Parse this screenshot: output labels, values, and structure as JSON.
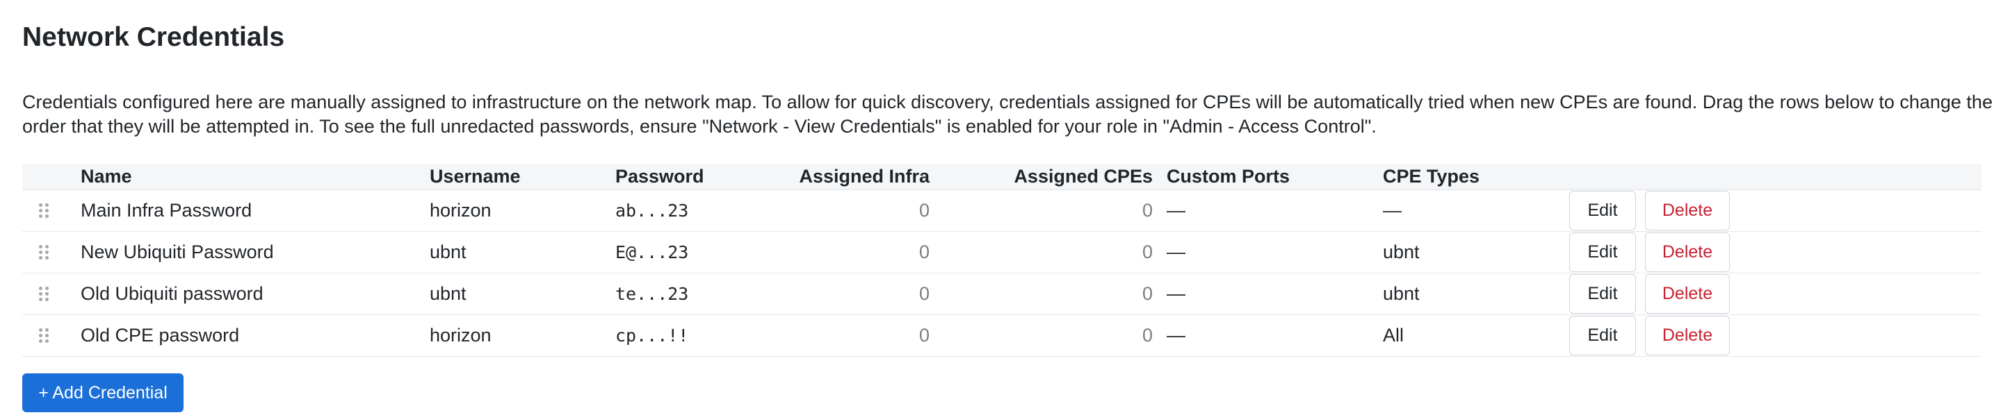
{
  "page": {
    "title": "Network Credentials",
    "description": "Credentials configured here are manually assigned to infrastructure on the network map. To allow for quick discovery, credentials assigned for CPEs will be automatically tried when new CPEs are found. Drag the rows below to change the order that they will be attempted in. To see the full unredacted passwords, ensure \"Network - View Credentials\" is enabled for your role in \"Admin - Access Control\"."
  },
  "table": {
    "headers": {
      "name": "Name",
      "username": "Username",
      "password": "Password",
      "assigned_infra": "Assigned Infra",
      "assigned_cpes": "Assigned CPEs",
      "custom_ports": "Custom Ports",
      "cpe_types": "CPE Types"
    },
    "rows": [
      {
        "name": "Main Infra Password",
        "username": "horizon",
        "password": "ab...23",
        "assigned_infra": "0",
        "assigned_cpes": "0",
        "custom_ports": "—",
        "cpe_types": "—",
        "edit_label": "Edit",
        "delete_label": "Delete"
      },
      {
        "name": "New Ubiquiti Password",
        "username": "ubnt",
        "password": "E@...23",
        "assigned_infra": "0",
        "assigned_cpes": "0",
        "custom_ports": "—",
        "cpe_types": "ubnt",
        "edit_label": "Edit",
        "delete_label": "Delete"
      },
      {
        "name": "Old Ubiquiti password",
        "username": "ubnt",
        "password": "te...23",
        "assigned_infra": "0",
        "assigned_cpes": "0",
        "custom_ports": "—",
        "cpe_types": "ubnt",
        "edit_label": "Edit",
        "delete_label": "Delete"
      },
      {
        "name": "Old CPE password",
        "username": "horizon",
        "password": "cp...!!",
        "assigned_infra": "0",
        "assigned_cpes": "0",
        "custom_ports": "—",
        "cpe_types": "All",
        "edit_label": "Edit",
        "delete_label": "Delete"
      }
    ]
  },
  "actions": {
    "add_credential_label": "+ Add Credential"
  },
  "icons": {
    "drag_handle": "drag-handle-icon"
  },
  "colors": {
    "primary": "#1a6fd8",
    "danger": "#c82333",
    "header_bg": "#f5f6f8"
  }
}
